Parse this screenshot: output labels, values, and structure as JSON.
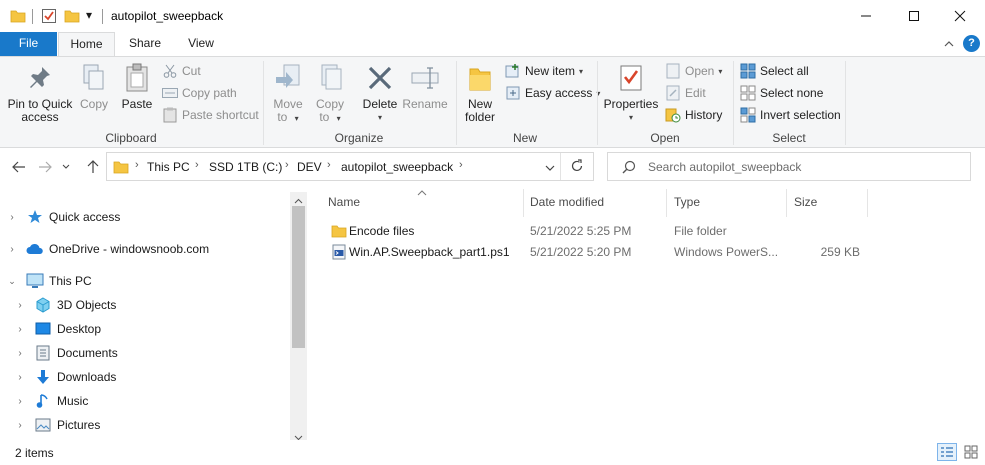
{
  "window": {
    "title": "autopilot_sweepback",
    "qat_dropdown": "▾"
  },
  "ribbon_tabs": {
    "file": "File",
    "home": "Home",
    "share": "Share",
    "view": "View"
  },
  "clipboard": {
    "group": "Clipboard",
    "pin_line1": "Pin to Quick",
    "pin_line2": "access",
    "copy": "Copy",
    "paste": "Paste",
    "cut": "Cut",
    "copy_path": "Copy path",
    "paste_shortcut": "Paste shortcut"
  },
  "organize": {
    "group": "Organize",
    "move_to_line1": "Move",
    "move_to_line2": "to",
    "copy_to_line1": "Copy",
    "copy_to_line2": "to",
    "delete": "Delete",
    "rename": "Rename"
  },
  "new": {
    "group": "New",
    "folder_line1": "New",
    "folder_line2": "folder",
    "new_item": "New item",
    "easy_access": "Easy access"
  },
  "open": {
    "group": "Open",
    "properties": "Properties",
    "open": "Open",
    "edit": "Edit",
    "history": "History"
  },
  "select": {
    "group": "Select",
    "select_all": "Select all",
    "select_none": "Select none",
    "invert": "Invert selection"
  },
  "address": {
    "crumbs": [
      "This PC",
      "SSD 1TB (C:)",
      "DEV",
      "autopilot_sweepback"
    ],
    "search_placeholder": "Search autopilot_sweepback"
  },
  "nav": {
    "items": [
      {
        "label": "Quick access",
        "icon": "star-icon"
      },
      {
        "label": "OneDrive - windowsnoob.com",
        "icon": "cloud-icon"
      },
      {
        "label": "This PC",
        "icon": "computer-icon"
      },
      {
        "label": "3D Objects",
        "icon": "cube-icon"
      },
      {
        "label": "Desktop",
        "icon": "desktop-icon"
      },
      {
        "label": "Documents",
        "icon": "document-icon"
      },
      {
        "label": "Downloads",
        "icon": "download-icon"
      },
      {
        "label": "Music",
        "icon": "music-icon"
      },
      {
        "label": "Pictures",
        "icon": "picture-icon"
      }
    ]
  },
  "columns": {
    "name": "Name",
    "date": "Date modified",
    "type": "Type",
    "size": "Size"
  },
  "files": [
    {
      "name": "Encode files",
      "date": "5/21/2022 5:25 PM",
      "type": "File folder",
      "size": ""
    },
    {
      "name": "Win.AP.Sweepback_part1.ps1",
      "date": "5/21/2022 5:20 PM",
      "type": "Windows PowerS...",
      "size": "259 KB"
    }
  ],
  "status": {
    "count": "2 items"
  },
  "colors": {
    "accent": "#1979ca",
    "folder": "#f5c542",
    "ribbon_bg": "#f5f6f7"
  }
}
